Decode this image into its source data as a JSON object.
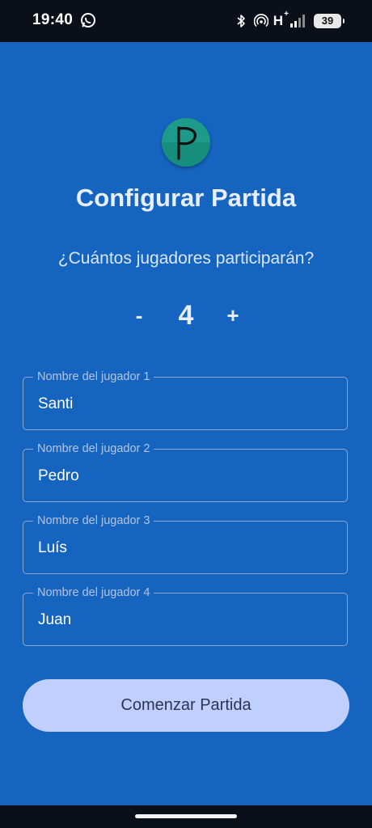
{
  "status_bar": {
    "time": "19:40",
    "network_type": "H",
    "network_plus": "+",
    "battery_level": "39",
    "icons": [
      "whatsapp-icon",
      "bluetooth-icon",
      "hotspot-icon",
      "signal-icon",
      "battery-icon"
    ]
  },
  "app": {
    "logo_letter": "P",
    "title": "Configurar Partida",
    "question": "¿Cuántos jugadores participarán?"
  },
  "stepper": {
    "minus_label": "-",
    "value": "4",
    "plus_label": "+"
  },
  "players": [
    {
      "label": "Nombre del jugador 1",
      "value": "Santi"
    },
    {
      "label": "Nombre del jugador 2",
      "value": "Pedro"
    },
    {
      "label": "Nombre del jugador 3",
      "value": "Luís"
    },
    {
      "label": "Nombre del jugador 4",
      "value": "Juan"
    }
  ],
  "start_button_label": "Comenzar Partida",
  "colors": {
    "background": "#1565c0",
    "button": "#c0cffe",
    "button_text": "#2b3553",
    "logo": "#1e9a8a",
    "field_border": "#8ea6cf"
  }
}
